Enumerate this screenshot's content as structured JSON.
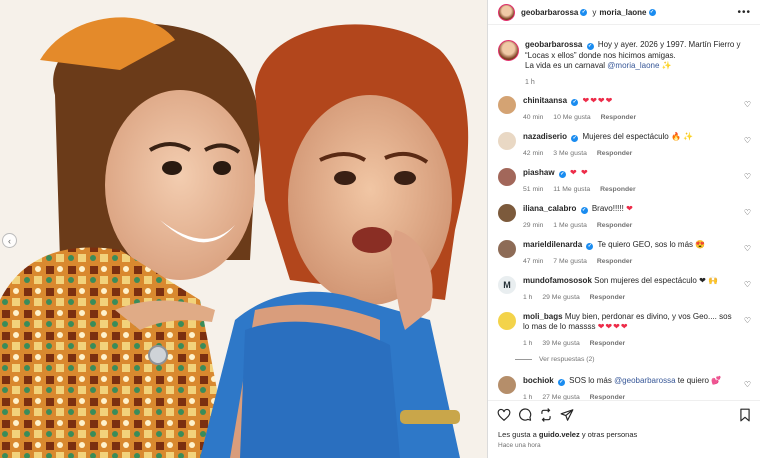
{
  "header": {
    "user1": "geobarbarossa",
    "connector": "y",
    "user2": "moria_laone",
    "more_label": "•••"
  },
  "caption": {
    "username": "geobarbarossa",
    "text": "Hoy y ayer. 2026 y 1997. Martín Fierro y “Locas x ellos” donde nos hicimos amigas.",
    "text2": "La vida es un carnaval",
    "mention": "@moria_laone",
    "emoji": "✨",
    "time": "1 h"
  },
  "comments": [
    {
      "username": "chinitaansa",
      "text": "",
      "emoji": "❤❤❤❤",
      "time": "40 min",
      "likes": "10 Me gusta",
      "reply": "Responder",
      "avatar_color": "#d4a373"
    },
    {
      "username": "nazadiserio",
      "text": "Mujeres del espectáculo",
      "emoji": "🔥 ✨",
      "time": "42 min",
      "likes": "3 Me gusta",
      "reply": "Responder",
      "avatar_color": "#e9d8c4"
    },
    {
      "username": "piashaw",
      "text": "",
      "emoji": "❤ ❤",
      "time": "51 min",
      "likes": "11 Me gusta",
      "reply": "Responder",
      "avatar_color": "#a2675a"
    },
    {
      "username": "iliana_calabro",
      "text": "Bravo!!!!!",
      "emoji": "❤",
      "time": "29 min",
      "likes": "1 Me gusta",
      "reply": "Responder",
      "avatar_color": "#7c5a3c"
    },
    {
      "username": "marieldilenarda",
      "text": "Te quiero GEO, sos lo más",
      "emoji": "😍",
      "time": "47 min",
      "likes": "7 Me gusta",
      "reply": "Responder",
      "avatar_color": "#8d6b56"
    },
    {
      "username": "mundofamososok",
      "text": "Son mujeres del espectáculo",
      "emoji": "❤ 🙌",
      "time": "1 h",
      "likes": "29 Me gusta",
      "reply": "Responder",
      "avatar_color": "#e9eef0",
      "avatar_letter": "M"
    },
    {
      "username": "moli_bags",
      "text": "Muy bien, perdonar es divino, y vos Geo.... sos lo mas de lo massss",
      "emoji": "❤❤❤❤",
      "time": "1 h",
      "likes": "39 Me gusta",
      "reply": "Responder",
      "avatar_color": "#f3d34a"
    },
    {
      "username": "bochiok",
      "text": "SOS lo más",
      "mention": "@geobarbarossa",
      "extra": "te quiero",
      "emoji": "💕",
      "time": "1 h",
      "likes": "27 Me gusta",
      "reply": "Responder",
      "avatar_color": "#b58e6a"
    }
  ],
  "view_replies": "Ver respuestas (2)",
  "likes": {
    "prefix": "Les gusta a",
    "user": "guido.velez",
    "suffix": "y otras personas"
  },
  "ago": "Hace una hora",
  "icons": [
    "heart-icon",
    "comment-icon",
    "repost-icon",
    "share-icon",
    "bookmark-icon",
    "chevron-left-icon",
    "verified-icon"
  ],
  "colors": {
    "link": "#385898",
    "verified": "#1a8cf0",
    "heart": "#ed2c49",
    "muted": "#737373"
  }
}
